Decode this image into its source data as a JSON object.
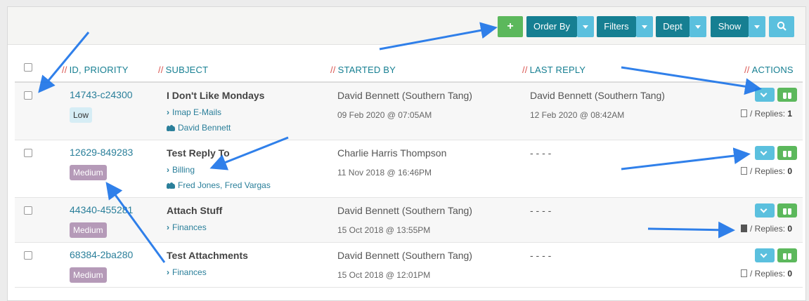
{
  "toolbar": {
    "add_label": "+",
    "order_by_label": "Order By",
    "filters_label": "Filters",
    "dept_label": "Dept",
    "show_label": "Show",
    "search_icon": "search-icon"
  },
  "columns": {
    "id_priority": "ID, PRIORITY",
    "subject": "SUBJECT",
    "started_by": "STARTED BY",
    "last_reply": "LAST REPLY",
    "actions": "ACTIONS",
    "slash": "//"
  },
  "tickets": [
    {
      "id": "14743-c24300",
      "priority": "Low",
      "subject": "I Don't Like Mondays",
      "department": "Imap E-Mails",
      "users": "David Bennett",
      "started_by": "David Bennett (Southern Tang)",
      "started_date": "09 Feb 2020 @ 07:05AM",
      "last_reply_by": "David Bennett (Southern Tang)",
      "last_reply_date": "12 Feb 2020 @ 08:42AM",
      "replies_label": "/ Replies:",
      "replies": "1"
    },
    {
      "id": "12629-849283",
      "priority": "Medium",
      "subject": "Test Reply To",
      "department": "Billing",
      "users": "Fred Jones, Fred Vargas",
      "started_by": "Charlie Harris Thompson",
      "started_date": "11 Nov 2018 @ 16:46PM",
      "last_reply_by": "- - - -",
      "last_reply_date": "",
      "replies_label": "/ Replies:",
      "replies": "0"
    },
    {
      "id": "44340-455281",
      "priority": "Medium",
      "subject": "Attach Stuff",
      "department": "Finances",
      "users": "",
      "started_by": "David Bennett (Southern Tang)",
      "started_date": "15 Oct 2018 @ 13:55PM",
      "last_reply_by": "- - - -",
      "last_reply_date": "",
      "replies_label": "/ Replies:",
      "replies": "0"
    },
    {
      "id": "68384-2ba280",
      "priority": "Medium",
      "subject": "Test Attachments",
      "department": "Finances",
      "users": "",
      "started_by": "David Bennett (Southern Tang)",
      "started_date": "15 Oct 2018 @ 12:01PM",
      "last_reply_by": "- - - -",
      "last_reply_date": "",
      "replies_label": "/ Replies:",
      "replies": "0"
    }
  ],
  "colors": {
    "accent": "#167f92",
    "info": "#5bc0de",
    "success": "#5cb85c",
    "danger": "#d9534f",
    "annotation_arrow": "#1a73e8"
  }
}
